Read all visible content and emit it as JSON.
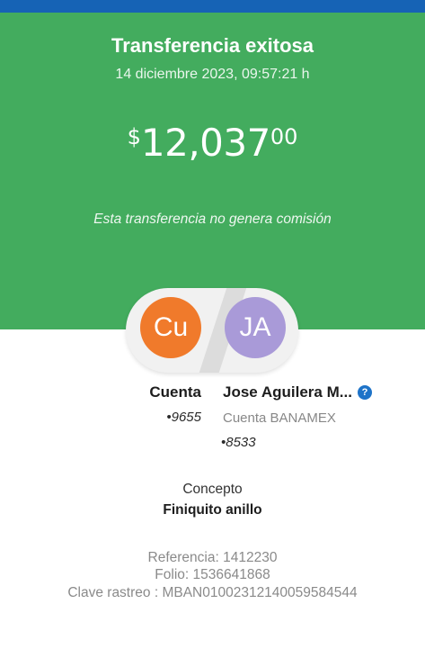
{
  "colors": {
    "header_strip": "#1663b5",
    "hero_green": "#43ac5e",
    "origin_avatar": "#f07a2b",
    "destination_avatar": "#a99ad8",
    "help_badge": "#1e73c8"
  },
  "receipt": {
    "title": "Transferencia exitosa",
    "datetime": "14 diciembre 2023, 09:57:21 h",
    "amount": {
      "currency_symbol": "$",
      "integer": "12,037",
      "decimals": "00"
    },
    "commission_note": "Esta transferencia no genera comisión"
  },
  "origin": {
    "avatar_initials": "Cu",
    "name": "Cuenta",
    "account": "•9655"
  },
  "destination": {
    "avatar_initials": "JA",
    "name": "Jose Aguilera M...",
    "help_icon": "help-circle-icon",
    "help_glyph": "?",
    "bank": "Cuenta BANAMEX",
    "account": "•8533"
  },
  "concept": {
    "label": "Concepto",
    "value": "Finiquito anillo"
  },
  "references": {
    "referencia": "Referencia: 1412230",
    "folio": "Folio: 1536641868",
    "clave_rastreo": "Clave rastreo : MBAN01002312140059584544"
  }
}
